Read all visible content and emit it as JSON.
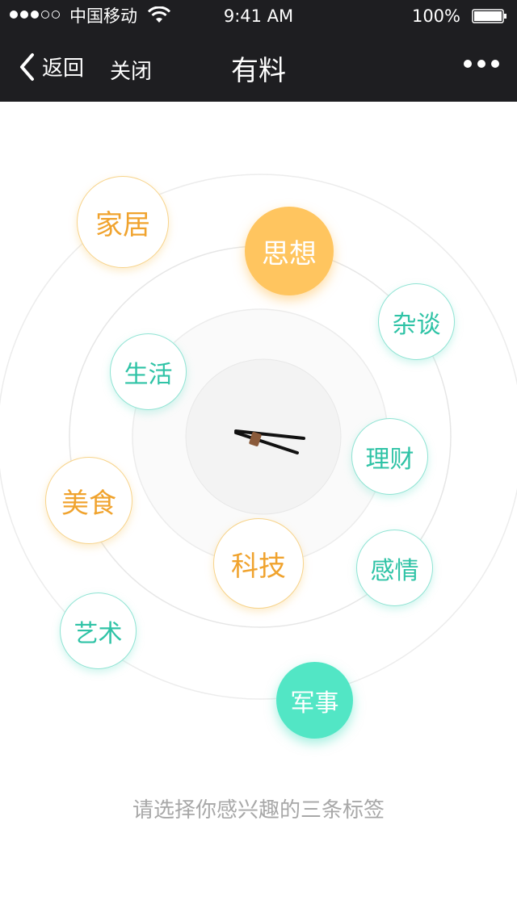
{
  "status": {
    "carrier": "中国移动",
    "time": "9:41 AM",
    "battery": "100%"
  },
  "nav": {
    "back_label": "返回",
    "close_label": "关闭",
    "title": "有料"
  },
  "tags": {
    "jiaju": "家居",
    "sixiang": "思想",
    "zatan": "杂谈",
    "shenghuo": "生活",
    "licai": "理财",
    "meishi": "美食",
    "keji": "科技",
    "ganqing": "感情",
    "yishu": "艺术",
    "junshi": "军事"
  },
  "hint": "请选择你感兴趣的三条标签",
  "colors": {
    "orange": "#f0a32e",
    "orange_selected": "#ffc55f",
    "teal": "#2fc3a6",
    "teal_selected": "#52e6c5",
    "bar": "#1e1e21"
  }
}
